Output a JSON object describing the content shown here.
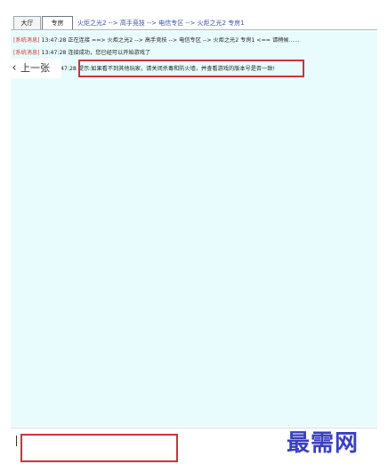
{
  "tabs": {
    "hall": "大厅",
    "room": "专房"
  },
  "breadcrumb": "火炬之光2 --> 高手竞技 --> 电信专区 --> 火炬之光2 专房1",
  "messages": [
    {
      "source": "[系统消息]",
      "time": "13:47:28",
      "text": "正在连接 ==> 火炬之光2 --> 高手竞技 --> 电信专区 --> 火炬之光2 专房1 <== 请稍候......"
    },
    {
      "source": "[系统消息]",
      "time": "13:47:28",
      "text": "连接成功，您已经可以开始游戏了"
    },
    {
      "source": "",
      "time": "47:28",
      "text": "提示:如果看不到其他玩家，请关闭杀毒和防火墙，并查看游戏的版本号是否一致!"
    }
  ],
  "prev_label": "上一张",
  "input": {
    "value": ""
  },
  "watermark": "最需网"
}
